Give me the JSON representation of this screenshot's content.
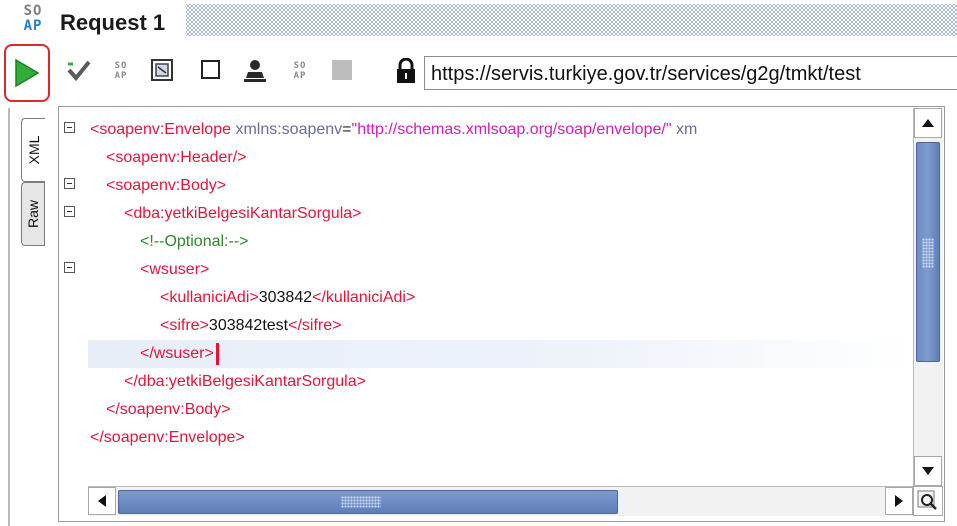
{
  "title": {
    "logo_top": "SO",
    "logo_bottom": "AP",
    "text": "Request 1"
  },
  "toolbar": {
    "run_icon": "play-icon",
    "validate_icon": "check-icon",
    "url": "https://servis.turkiye.gov.tr/services/g2g/tmkt/test",
    "lock_icon": "lock-icon"
  },
  "tabs": {
    "xml": "XML",
    "raw": "Raw"
  },
  "xml": {
    "envelope_open": "<soapenv:Envelope",
    "envelope_attr": " xmlns:soapenv",
    "envelope_eq": "=",
    "envelope_val": "\"http://schemas.xmlsoap.org/soap/envelope/\"",
    "envelope_attr2": " xm",
    "header": "<soapenv:Header/>",
    "body_open": "<soapenv:Body>",
    "op_open": "<dba:yetkiBelgesiKantarSorgula>",
    "comment": "<!--Optional:-->",
    "wsuser_open": "<wsuser>",
    "kullanici_open": "<kullaniciAdi>",
    "kullanici_val": "303842",
    "kullanici_close": "</kullaniciAdi>",
    "sifre_open": "<sifre>",
    "sifre_val": "303842test",
    "sifre_close": "</sifre>",
    "wsuser_close": "</wsuser>",
    "op_close": "</dba:yetkiBelgesiKantarSorgula>",
    "body_close": "</soapenv:Body>",
    "envelope_close": "</soapenv:Envelope>"
  },
  "colors": {
    "tag": "#e2163b",
    "value": "#d11fb3",
    "comment": "#2a8a2a",
    "run_green": "#2fae3a",
    "highlight_red": "#e3262a"
  }
}
